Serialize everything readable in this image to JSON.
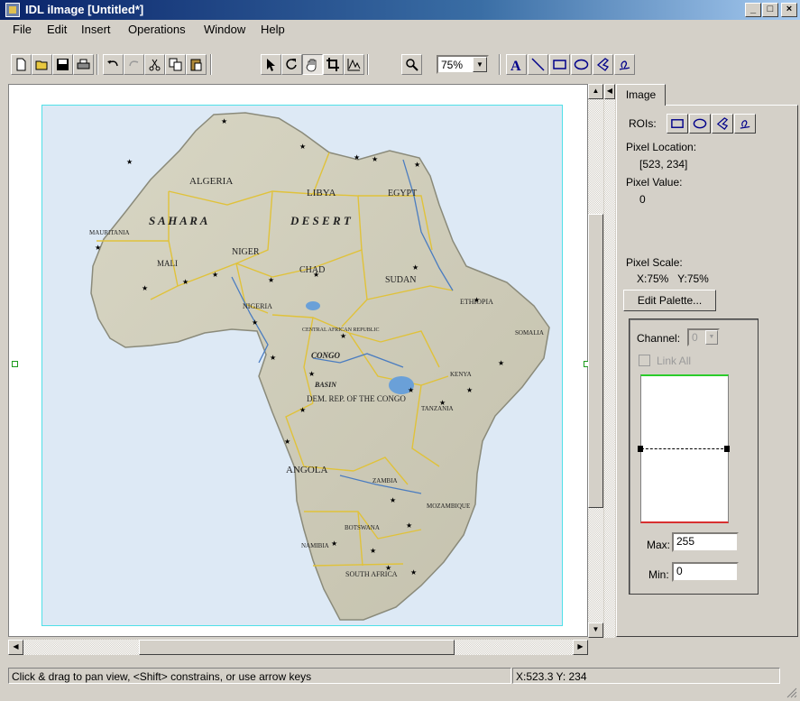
{
  "window": {
    "title": "IDL iImage [Untitled*]",
    "minimize": "_",
    "maximize": "□",
    "close": "×"
  },
  "menu": [
    "File",
    "Edit",
    "Insert",
    "Operations",
    "Window",
    "Help"
  ],
  "toolbar": {
    "zoom": "75%"
  },
  "map": {
    "labels": {
      "algeria": "ALGERIA",
      "libya": "LIBYA",
      "egypt": "EGYPT",
      "sahara": "S A H A R A",
      "desert": "D E S E R T",
      "mauritania": "MAURITANIA",
      "niger": "NIGER",
      "mali": "MALI",
      "chad": "CHAD",
      "sudan": "SUDAN",
      "nigeria": "NIGERIA",
      "car": "CENTRAL AFRICAN REPUBLIC",
      "congo": "CONGO",
      "basin": "BASIN",
      "drc": "DEM. REP. OF THE CONGO",
      "ethiopia": "ETHIOPIA",
      "somalia": "SOMALIA",
      "kenya": "KENYA",
      "tanzania": "TANZANIA",
      "angola": "ANGOLA",
      "zambia": "ZAMBIA",
      "mozambique": "MOZAMBIQUE",
      "namibia": "NAMIBIA",
      "botswana": "BOTSWANA",
      "south_africa": "SOUTH AFRICA"
    }
  },
  "panel": {
    "tab": "Image",
    "rois_label": "ROIs:",
    "pixel_location_label": "Pixel Location:",
    "pixel_location_value": "[523, 234]",
    "pixel_value_label": "Pixel Value:",
    "pixel_value": "0",
    "pixel_scale_label": "Pixel Scale:",
    "pixel_scale_value": "X:75%   Y:75%",
    "edit_palette": "Edit Palette...",
    "channel_label": "Channel:",
    "channel_value": "0",
    "link_all": "Link All",
    "max_label": "Max:",
    "max_value": "255",
    "min_label": "Min:",
    "min_value": "0"
  },
  "status": {
    "hint": "Click & drag to pan view, <Shift> constrains, or use arrow keys",
    "coords": "X:523.3  Y: 234"
  }
}
